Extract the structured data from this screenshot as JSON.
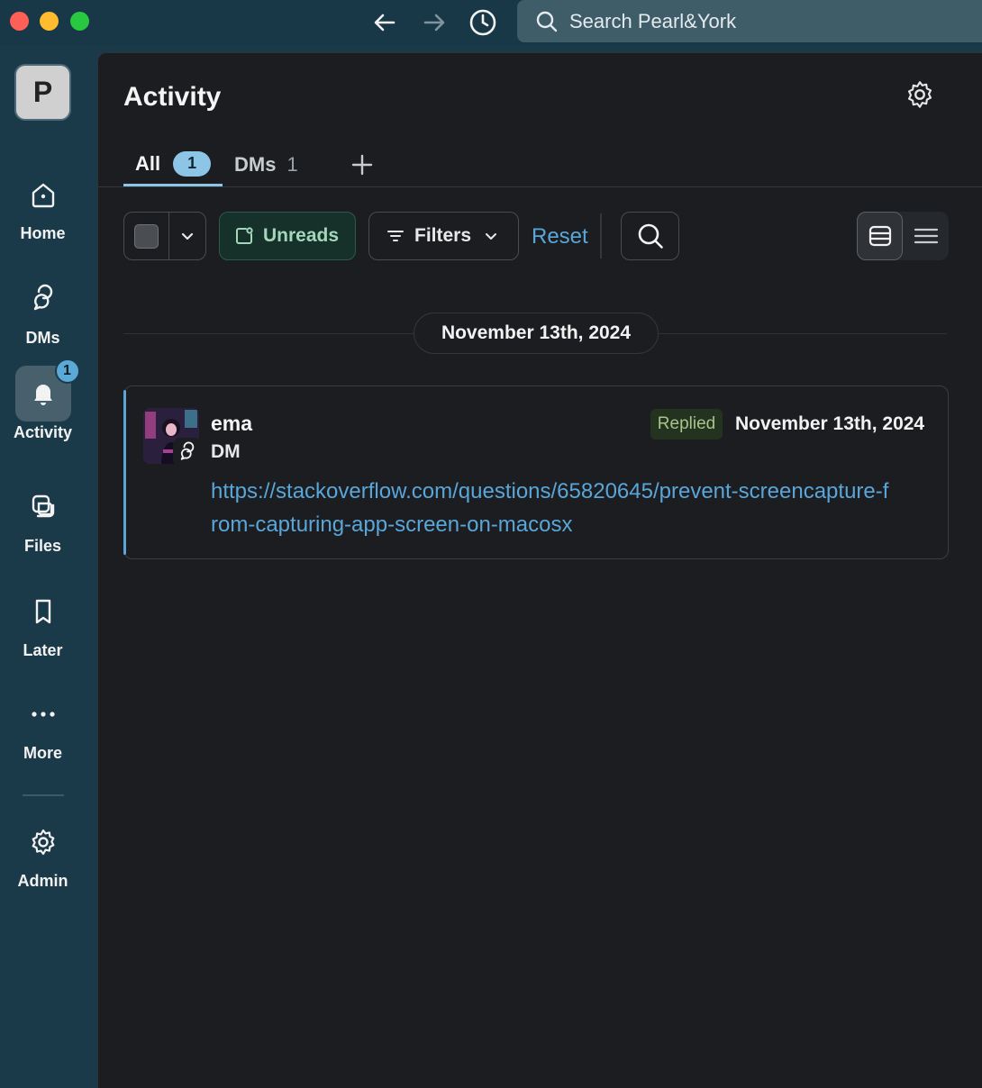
{
  "titlebar": {
    "search_placeholder": "Search Pearl&York"
  },
  "workspace": {
    "initial": "P"
  },
  "sidebar": {
    "items": [
      {
        "label": "Home",
        "icon": "home-icon"
      },
      {
        "label": "DMs",
        "icon": "dms-icon"
      },
      {
        "label": "Activity",
        "icon": "bell-icon",
        "badge": "1",
        "active": true
      },
      {
        "label": "Files",
        "icon": "files-icon"
      },
      {
        "label": "Later",
        "icon": "bookmark-icon"
      },
      {
        "label": "More",
        "icon": "more-icon"
      },
      {
        "label": "Admin",
        "icon": "gear-icon"
      }
    ]
  },
  "main": {
    "title": "Activity",
    "tabs": [
      {
        "label": "All",
        "count": "1",
        "active": true
      },
      {
        "label": "DMs",
        "count": "1"
      }
    ],
    "toolbar": {
      "unreads_label": "Unreads",
      "filters_label": "Filters",
      "reset_label": "Reset"
    },
    "date_divider": "November 13th, 2024",
    "activity_items": [
      {
        "name": "ema",
        "type": "DM",
        "status": "Replied",
        "date": "November 13th, 2024",
        "link": "https://stackoverflow.com/questions/65820645/prevent-screencapture-from-capturing-app-screen-on-macosx"
      }
    ]
  },
  "colors": {
    "sidebar_bg": "#1a3a4a",
    "main_bg": "#1b1d21",
    "accent_blue": "#5aa6d8",
    "unreads_green": "#a5d6bb",
    "replied_green": "#a7c48b"
  }
}
